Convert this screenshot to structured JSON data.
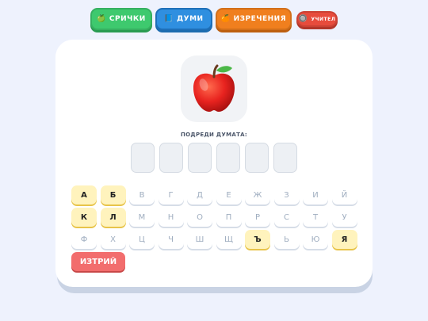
{
  "nav": {
    "words": {
      "icon": "🍏",
      "label": "СРИЧКИ"
    },
    "poems": {
      "icon": "📘",
      "label": "ДУМИ"
    },
    "sayings": {
      "icon": "🍊",
      "label": "ИЗРЕЧЕНИЯ"
    },
    "teacher": {
      "icon": "🔘",
      "label": "УЧИТЕЛ"
    }
  },
  "picture": {
    "emoji": "🍎",
    "icon": "apple-icon"
  },
  "prompt": "ПОДРЕДИ ДУМАТА:",
  "slot_count": 6,
  "keyboard": {
    "rows": [
      [
        {
          "l": "А",
          "on": true
        },
        {
          "l": "Б",
          "on": true
        },
        {
          "l": "В",
          "on": false
        },
        {
          "l": "Г",
          "on": false
        },
        {
          "l": "Д",
          "on": false
        },
        {
          "l": "Е",
          "on": false
        },
        {
          "l": "Ж",
          "on": false
        },
        {
          "l": "З",
          "on": false
        },
        {
          "l": "И",
          "on": false
        },
        {
          "l": "Й",
          "on": false
        }
      ],
      [
        {
          "l": "К",
          "on": true
        },
        {
          "l": "Л",
          "on": true
        },
        {
          "l": "М",
          "on": false
        },
        {
          "l": "Н",
          "on": false
        },
        {
          "l": "О",
          "on": false
        },
        {
          "l": "П",
          "on": false
        },
        {
          "l": "Р",
          "on": false
        },
        {
          "l": "С",
          "on": false
        },
        {
          "l": "Т",
          "on": false
        },
        {
          "l": "У",
          "on": false
        }
      ],
      [
        {
          "l": "Ф",
          "on": false
        },
        {
          "l": "Х",
          "on": false
        },
        {
          "l": "Ц",
          "on": false
        },
        {
          "l": "Ч",
          "on": false
        },
        {
          "l": "Ш",
          "on": false
        },
        {
          "l": "Щ",
          "on": false
        },
        {
          "l": "Ъ",
          "on": true
        },
        {
          "l": "Ь",
          "on": false
        },
        {
          "l": "Ю",
          "on": false
        },
        {
          "l": "Я",
          "on": true
        }
      ]
    ]
  },
  "delete_label": "ИЗТРИЙ"
}
